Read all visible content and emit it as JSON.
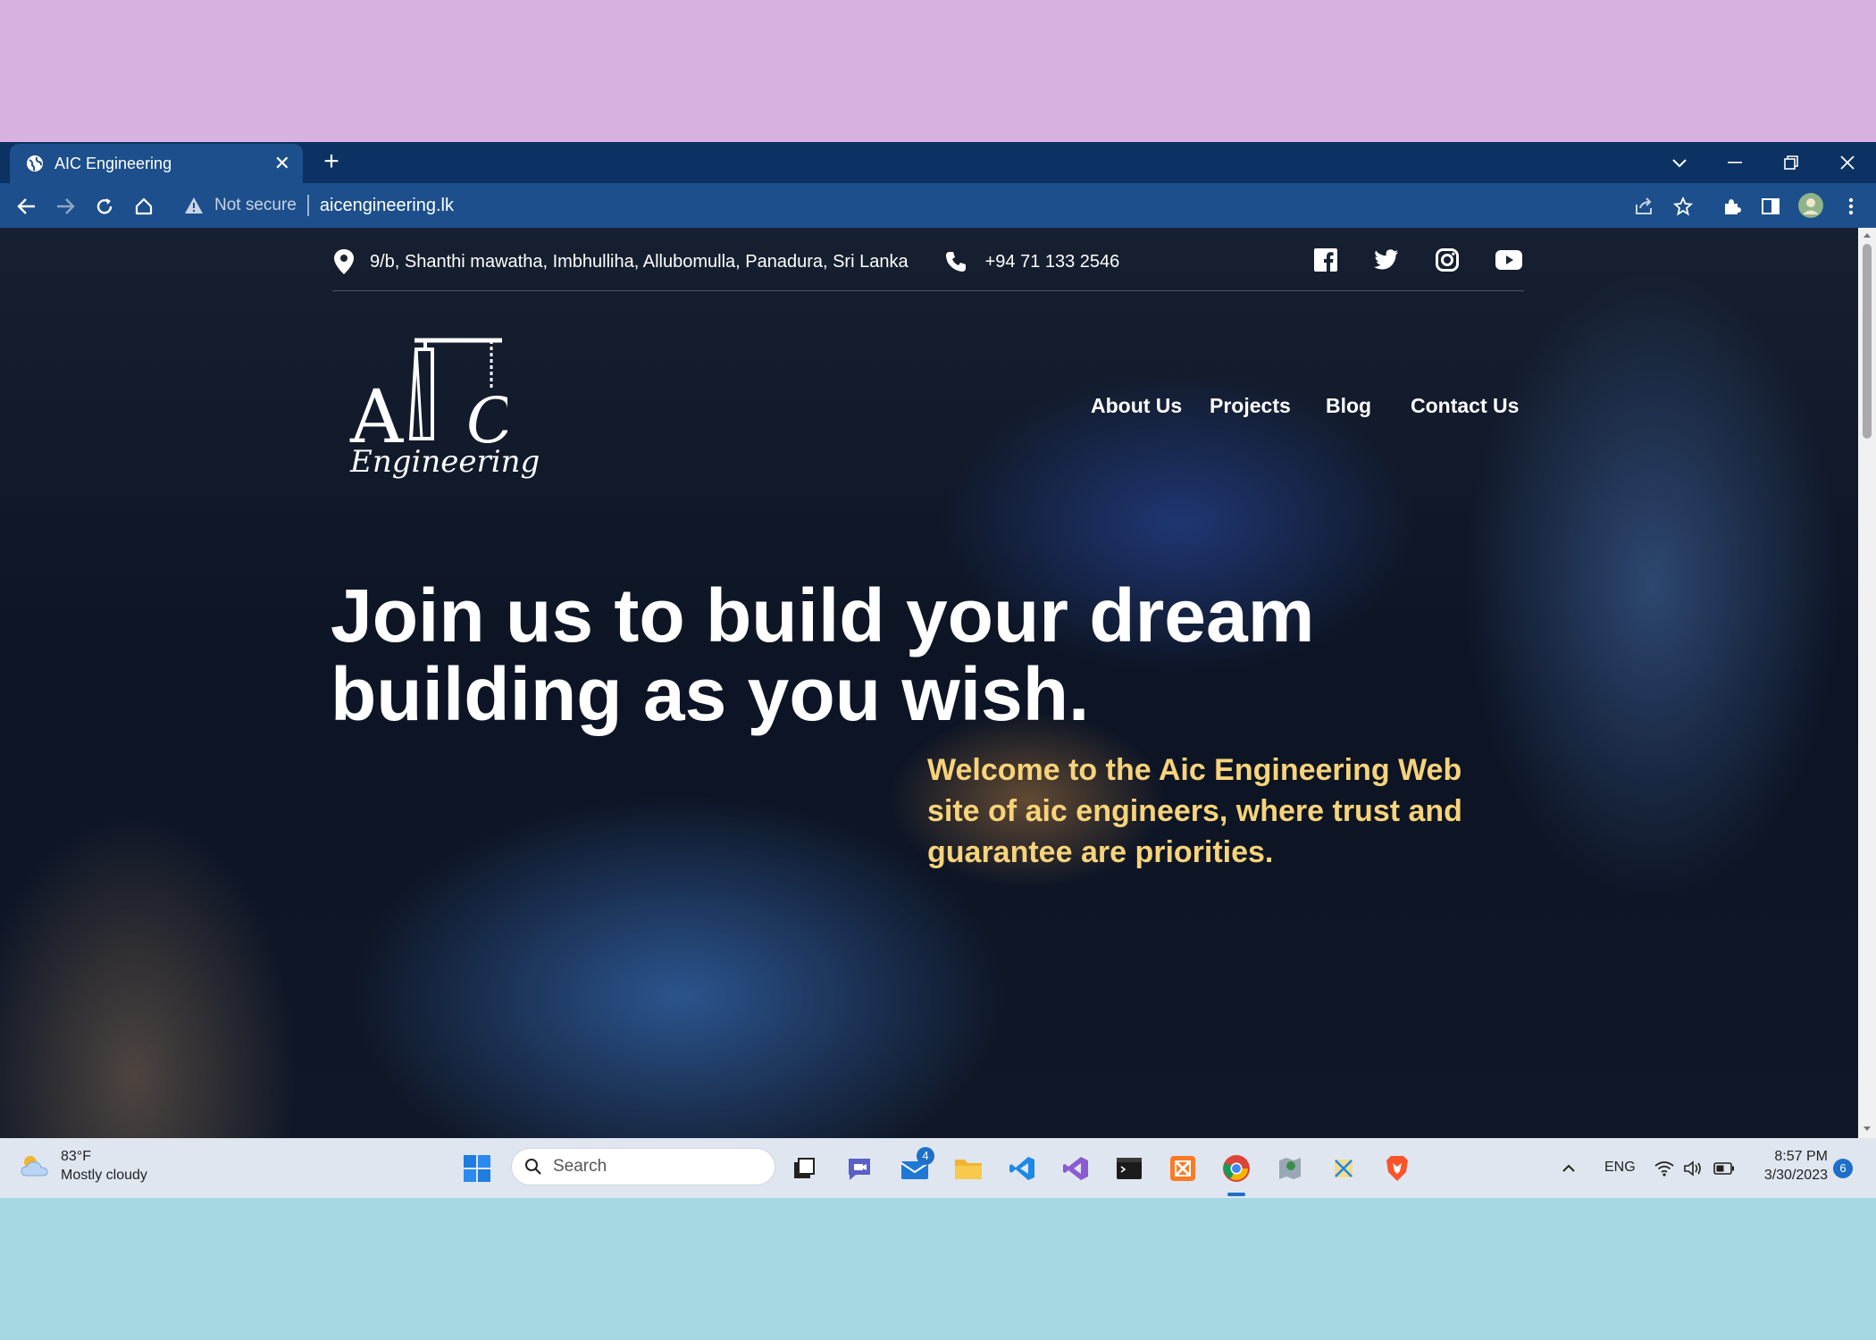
{
  "browser": {
    "tab_title": "AIC Engineering",
    "not_secure_label": "Not secure",
    "url": "aicengineering.lk"
  },
  "site": {
    "address": "9/b, Shanthi mawatha, Imbhulliha, Allubomulla, Panadura, Sri Lanka",
    "phone": "+94 71 133 2546",
    "logo_text": "Engineering",
    "nav": [
      "About Us",
      "Projects",
      "Blog",
      "Contact Us"
    ],
    "headline_line1": "Join us to build your dream",
    "headline_line2": "building as you wish.",
    "welcome_text": "Welcome to the Aic Engineering Web site of aic engineers, where trust and guarantee are priorities."
  },
  "taskbar": {
    "temperature": "83°F",
    "weather": "Mostly cloudy",
    "search_placeholder": "Search",
    "mail_badge": "4",
    "language": "ENG",
    "time": "8:57 PM",
    "date": "3/30/2023",
    "notification_count": "6"
  },
  "colors": {
    "tab_bar": "#0b3263",
    "toolbar": "#1c4f8b",
    "welcome_text": "#f7d37a",
    "top_background": "#d8b2de",
    "bottom_background": "#a5d8e3"
  }
}
